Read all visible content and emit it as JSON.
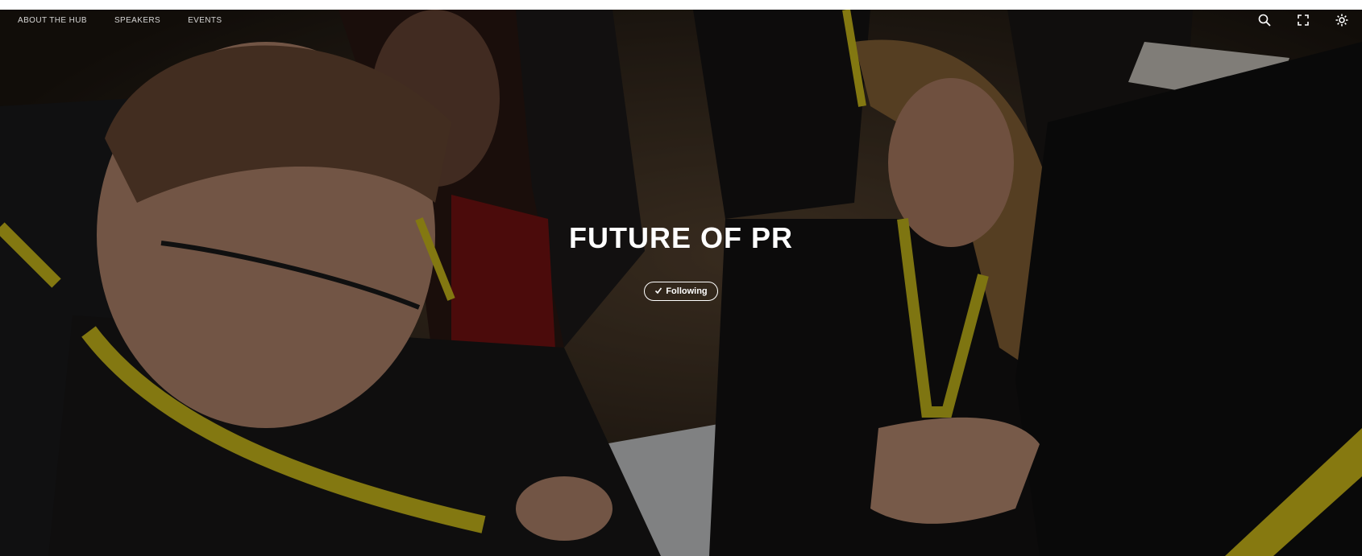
{
  "topnav": {
    "items": [
      {
        "label": "ABOUT THE HUB"
      },
      {
        "label": "SPEAKERS"
      },
      {
        "label": "EVENTS"
      }
    ]
  },
  "icons": {
    "search": "search-icon",
    "expand": "expand-icon",
    "settings": "gear-icon",
    "follow_check": "check-icon"
  },
  "hero": {
    "title": "FUTURE OF PR",
    "description": "",
    "follow_label": "Following"
  },
  "colors": {
    "lanyard": "#d9c81e",
    "text": "#ffffff",
    "scrim": "#000000"
  }
}
